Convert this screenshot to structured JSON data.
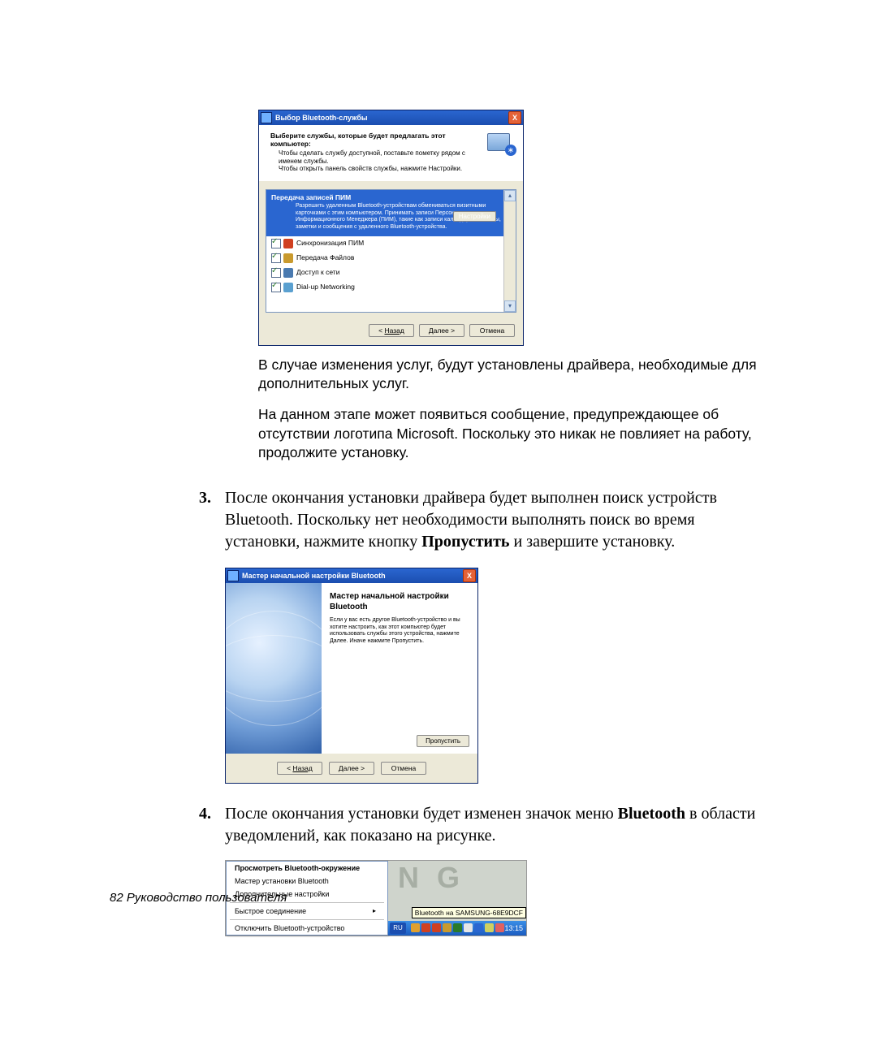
{
  "dlg1": {
    "title": "Выбор Bluetooth-службы",
    "close": "X",
    "hdr_title": "Выберите службы, которые будет предлагать этот компьютер:",
    "hdr_sub1": "Чтобы сделать службу доступной, поставьте пометку рядом с именем службы.",
    "hdr_sub2": "Чтобы открыть панель свойств службы, нажмите Настройки.",
    "selected": {
      "title": "Передача записей ПИМ",
      "desc": "Разрешить удаленным Bluetooth-устройствам обмениваться визитными карточками с этим компьютером. Принимать записи Персонального Информационного Менеджера (ПИМ), такие как записи календаря, контакты, заметки и сообщения с удаленного Bluetooth-устройства.",
      "cfg": "Настройки"
    },
    "items": [
      {
        "label": "Синхронизация ПИМ",
        "color": "#d04020"
      },
      {
        "label": "Передача Файлов",
        "color": "#c99a2e"
      },
      {
        "label": "Доступ к сети",
        "color": "#4a7ab0"
      },
      {
        "label": "Dial-up Networking",
        "color": "#5aa0d0"
      }
    ],
    "btns": {
      "back": "Назад",
      "back_pre": "< ",
      "next": "Далее >",
      "cancel": "Отмена"
    }
  },
  "para1": "В случае изменения услуг, будут установлены драйвера, необходимые для дополнительных услуг.",
  "para2": "На данном этапе может появиться сообщение, предупреждающее об отсутствии логотипа Microsoft. Поскольку это никак не повлияет на работу, продолжите установку.",
  "step3": {
    "num": "3.",
    "t1": "После окончания установки драйвера будет выполнен поиск устройств Bluetooth. Поскольку нет необходимости выполнять поиск во время установки, нажмите кнопку ",
    "bold": "Пропустить",
    "t2": "  и завершите установку."
  },
  "dlg2": {
    "title": "Мастер начальной настройки Bluetooth",
    "close": "X",
    "body_title": "Мастер начальной настройки Bluetooth",
    "body_desc": "Если у вас есть другое Bluetooth-устройство и вы хотите настроить, как этот компьютер будет использовать службы этого устройства, нажмите Далее. Иначе нажмите Пропустить.",
    "skip": "Пропустить",
    "btns": {
      "back": "Назад",
      "back_pre": "< ",
      "next": "Далее >",
      "cancel": "Отмена"
    }
  },
  "step4": {
    "num": "4.",
    "t1": "После окончания установки будет изменен значок меню ",
    "bold": "Bluetooth",
    "t2": " в области уведомлений, как показано на рисунке."
  },
  "menu": {
    "m1": "Просмотреть Bluetooth-окружение",
    "m2": "Мастер установки Bluetooth",
    "m3": "Дополнительные настройки",
    "m4": "Быстрое соединение",
    "m5": "Отключить Bluetooth-устройство",
    "bg_glyphs": "N  G",
    "tooltip": "Bluetooth на SAMSUNG-68E9DCF",
    "lang": "RU",
    "clock": "13:15",
    "tray_colors": [
      "#e0a030",
      "#d04020",
      "#d04020",
      "#c99a2e",
      "#2a7a2a",
      "#e6e6e6",
      "#2a66d0",
      "#d0d060",
      "#e06060"
    ]
  },
  "footer": "82  Руководство пользователя"
}
